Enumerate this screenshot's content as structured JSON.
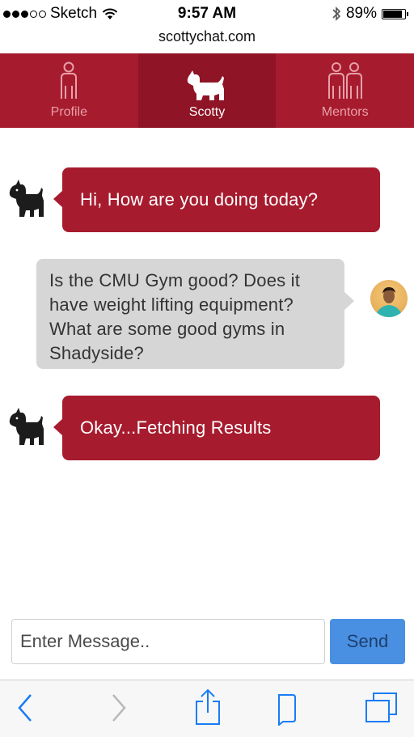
{
  "status_bar": {
    "carrier": "Sketch",
    "time": "9:57 AM",
    "battery_percent": "89%",
    "battery_level": 0.89,
    "signal_bars_filled": 3,
    "signal_bars_total": 5
  },
  "browser": {
    "url": "scottychat.com"
  },
  "tabs": [
    {
      "label": "Profile",
      "icon": "person-icon",
      "active": false
    },
    {
      "label": "Scotty",
      "icon": "scottie-dog-icon",
      "active": true
    },
    {
      "label": "Mentors",
      "icon": "two-people-icon",
      "active": false
    }
  ],
  "messages": [
    {
      "sender": "scotty",
      "text": "Hi, How are you doing today?"
    },
    {
      "sender": "user",
      "lines": [
        "Is the CMU Gym good? Does it",
        "have weight lifting equipment?",
        "What are some good gyms in",
        "Shadyside?"
      ]
    },
    {
      "sender": "scotty",
      "text": "Okay...Fetching Results"
    }
  ],
  "composer": {
    "placeholder": "Enter Message..",
    "send_label": "Send"
  },
  "toolbar": {
    "items": [
      "back-icon",
      "forward-icon",
      "share-icon",
      "bookmarks-icon",
      "tabs-icon"
    ]
  },
  "colors": {
    "brand_red": "#a71b2e",
    "brand_red_active": "#8f1426",
    "user_bubble": "#d6d6d6",
    "send_button": "#4a90e2",
    "ios_blue": "#1a7cf5"
  }
}
